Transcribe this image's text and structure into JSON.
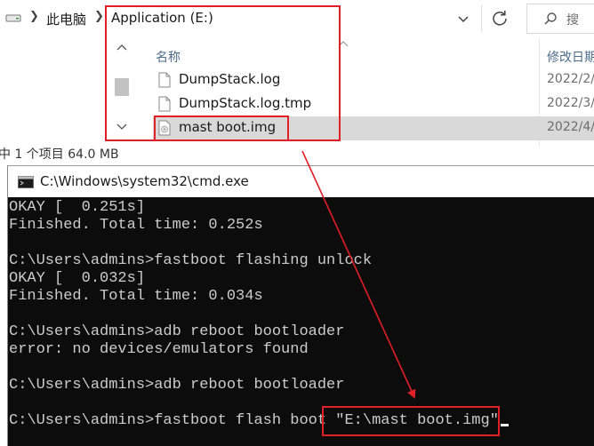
{
  "explorer": {
    "breadcrumb": {
      "this_pc": "此电脑",
      "current": "Application (E:)"
    },
    "search_hint": "搜",
    "columns": {
      "name": "名称",
      "date": "修改日期"
    },
    "files": [
      {
        "name": "DumpStack.log",
        "date": "2022/2/"
      },
      {
        "name": "DumpStack.log.tmp",
        "date": "2022/3/"
      },
      {
        "name": "mast boot.img",
        "date": "2022/4/",
        "selected": true
      }
    ],
    "status": "中 1 个项目  64.0 MB"
  },
  "cmd": {
    "title": "C:\\Windows\\system32\\cmd.exe",
    "lines": [
      "OKAY [  0.251s]",
      "Finished. Total time: 0.252s",
      "",
      "C:\\Users\\admins>fastboot flashing unlock",
      "OKAY [  0.032s]",
      "Finished. Total time: 0.034s",
      "",
      "C:\\Users\\admins>adb reboot bootloader",
      "error: no devices/emulators found",
      "",
      "C:\\Users\\admins>adb reboot bootloader",
      "",
      "C:\\Users\\admins>fastboot flash boot \"E:\\mast boot.img\""
    ]
  },
  "colors": {
    "highlight": "#e01f26",
    "console_bg": "#0c0c0c",
    "console_text": "#cccccc"
  },
  "icons": {
    "drive": "drive-icon",
    "refresh": "refresh-icon",
    "search": "search-icon",
    "file": "file-icon",
    "image_file": "disc-image-icon",
    "console": "cmd-icon"
  }
}
